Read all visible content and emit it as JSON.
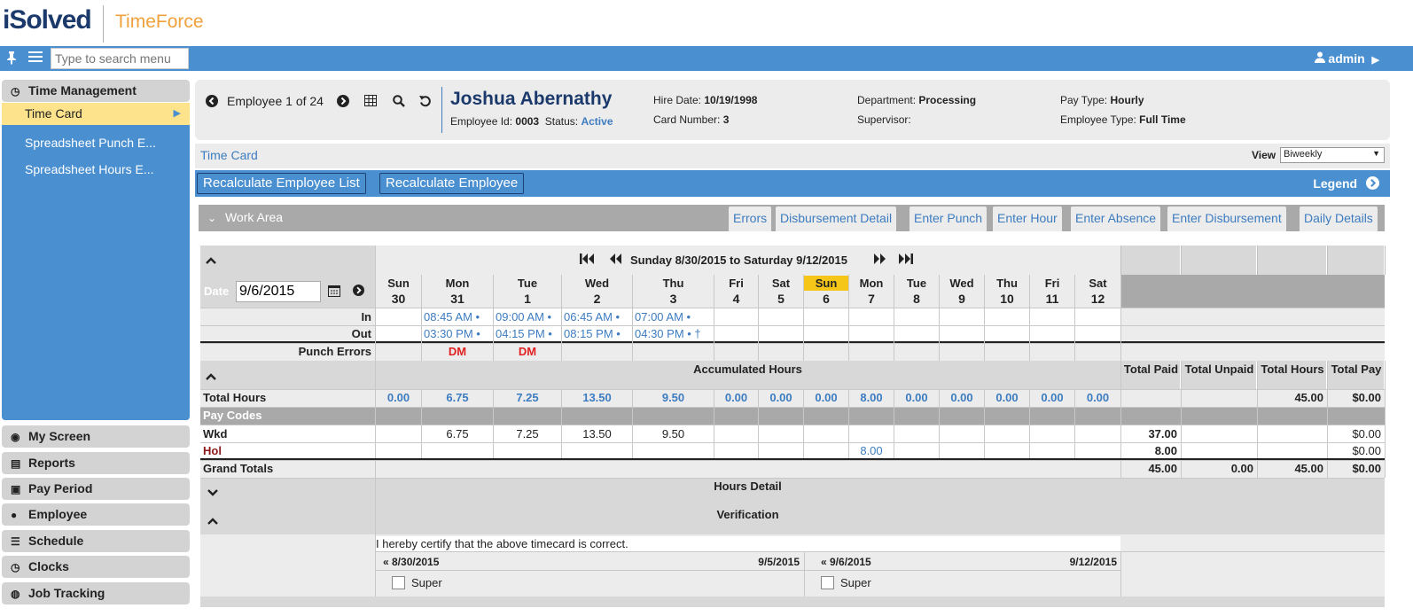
{
  "app": {
    "logo_brand": "iSolved",
    "logo_product": "TimeForce"
  },
  "topbar": {
    "search_placeholder": "Type to search menu",
    "user": "admin"
  },
  "sidebar": {
    "section": "Time Management",
    "subitems": [
      "Time Card",
      "Spreadsheet Punch E...",
      "Spreadsheet Hours E..."
    ],
    "bottom": [
      "My Screen",
      "Reports",
      "Pay Period",
      "Employee",
      "Schedule",
      "Clocks",
      "Job Tracking"
    ]
  },
  "employee": {
    "counter": "Employee 1 of 24",
    "name": "Joshua Abernathy",
    "id_label": "Employee Id:",
    "id": "0003",
    "status_label": "Status:",
    "status": "Active",
    "hire_label": "Hire Date:",
    "hire": "10/19/1998",
    "card_label": "Card Number:",
    "card": "3",
    "dept_label": "Department:",
    "dept": "Processing",
    "sup_label": "Supervisor:",
    "paytype_label": "Pay Type:",
    "paytype": "Hourly",
    "emptype_label": "Employee Type:",
    "emptype": "Full Time"
  },
  "timecard": {
    "title": "Time Card",
    "view_label": "View",
    "view_value": "Biweekly"
  },
  "actions": {
    "recalc_list": "Recalculate Employee List",
    "recalc_emp": "Recalculate Employee",
    "legend": "Legend"
  },
  "workarea": {
    "title": "Work Area",
    "tabs": [
      "Errors",
      "Disbursement Detail",
      "Enter Punch",
      "Enter Hour",
      "Enter Absence",
      "Enter Disbursement",
      "Daily Details"
    ]
  },
  "grid": {
    "range": "Sunday 8/30/2015 to Saturday 9/12/2015",
    "date_label": "Date",
    "date_value": "9/6/2015",
    "days": [
      {
        "dow": "Sun",
        "num": "30"
      },
      {
        "dow": "Mon",
        "num": "31"
      },
      {
        "dow": "Tue",
        "num": "1"
      },
      {
        "dow": "Wed",
        "num": "2"
      },
      {
        "dow": "Thu",
        "num": "3"
      },
      {
        "dow": "Fri",
        "num": "4"
      },
      {
        "dow": "Sat",
        "num": "5"
      },
      {
        "dow": "Sun",
        "num": "6"
      },
      {
        "dow": "Mon",
        "num": "7"
      },
      {
        "dow": "Tue",
        "num": "8"
      },
      {
        "dow": "Wed",
        "num": "9"
      },
      {
        "dow": "Thu",
        "num": "10"
      },
      {
        "dow": "Fri",
        "num": "11"
      },
      {
        "dow": "Sat",
        "num": "12"
      }
    ],
    "in_label": "In",
    "out_label": "Out",
    "in_vals": [
      "",
      "08:45 AM •",
      "09:00 AM •",
      "06:45 AM •",
      "07:00 AM •",
      "",
      "",
      "",
      "",
      "",
      "",
      "",
      "",
      ""
    ],
    "out_vals": [
      "",
      "03:30 PM •",
      "04:15 PM •",
      "08:15 PM •",
      "04:30 PM • †",
      "",
      "",
      "",
      "",
      "",
      "",
      "",
      "",
      ""
    ],
    "punch_errors_label": "Punch Errors",
    "punch_errors": [
      "",
      "DM",
      "DM",
      "",
      "",
      "",
      "",
      "",
      "",
      "",
      "",
      "",
      "",
      ""
    ],
    "accum_label": "Accumulated Hours",
    "total_cols": [
      "Total Paid",
      "Total Unpaid",
      "Total Hours",
      "Total Pay"
    ],
    "total_hours_label": "Total Hours",
    "total_hours": [
      "0.00",
      "6.75",
      "7.25",
      "13.50",
      "9.50",
      "0.00",
      "0.00",
      "0.00",
      "8.00",
      "0.00",
      "0.00",
      "0.00",
      "0.00",
      "0.00"
    ],
    "total_hours_totals": [
      "",
      "",
      "45.00",
      "$0.00"
    ],
    "paycodes_label": "Pay Codes",
    "wkd_label": "Wkd",
    "wkd": [
      "",
      "6.75",
      "7.25",
      "13.50",
      "9.50",
      "",
      "",
      "",
      "",
      "",
      "",
      "",
      "",
      ""
    ],
    "wkd_totals": [
      "37.00",
      "",
      "",
      "$0.00"
    ],
    "hol_label": "Hol",
    "hol": [
      "",
      "",
      "",
      "",
      "",
      "",
      "",
      "",
      "8.00",
      "",
      "",
      "",
      "",
      ""
    ],
    "hol_totals": [
      "8.00",
      "",
      "",
      "$0.00"
    ],
    "grand_label": "Grand Totals",
    "grand_totals": [
      "45.00",
      "0.00",
      "45.00",
      "$0.00"
    ],
    "hours_detail": "Hours Detail",
    "verification": "Verification",
    "certify": "I hereby certify that the above timecard is correct.",
    "period1_start": "« 8/30/2015",
    "period1_end": "9/5/2015",
    "period2_start": "« 9/6/2015",
    "period2_end": "9/12/2015",
    "super1": "Super",
    "super2": "Super"
  }
}
